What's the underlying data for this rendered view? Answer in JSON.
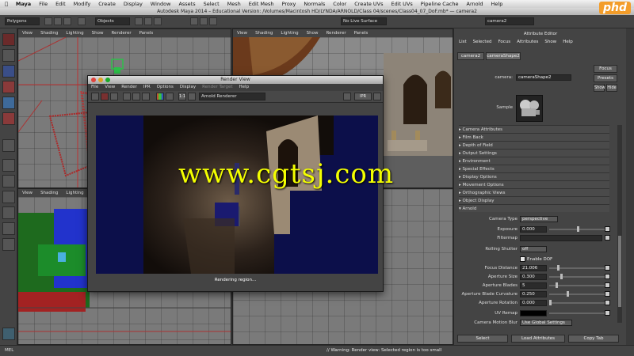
{
  "mac_menu": [
    "Maya",
    "File",
    "Edit",
    "Modify",
    "Create",
    "Display",
    "Window",
    "Assets",
    "Select",
    "Mesh",
    "Edit Mesh",
    "Proxy",
    "Normals",
    "Color",
    "Create UVs",
    "Edit UVs",
    "Pipeline Cache",
    "Arnold",
    "Help"
  ],
  "window_title": "Autodesk Maya 2014 – Educational Version: /Volumes/Macintosh HD/LYNDA/ARNOLD/Class 04/scenes/Class04_07_DoF.mb* — camera2",
  "status_line": {
    "menu_set": "Polygons",
    "objects_field": "Objects",
    "live_surface": "No Live Surface",
    "name_field": "camera2"
  },
  "pane_menu": [
    "View",
    "Shading",
    "Lighting",
    "Show",
    "Renderer",
    "Panels"
  ],
  "render_view": {
    "title": "Render View",
    "menu": [
      "File",
      "View",
      "Render",
      "IPR",
      "Options",
      "Display",
      "Render Target",
      "Help"
    ],
    "renderer": "Arnold Renderer",
    "zoom": "1:1",
    "ratio": "IPR",
    "status": "Rendering region..."
  },
  "attribute_editor": {
    "title": "Attribute Editor",
    "menu": [
      "List",
      "Selected",
      "Focus",
      "Attributes",
      "Show",
      "Help"
    ],
    "tabs": [
      "camera2",
      "cameraShape2"
    ],
    "node_label": "camera:",
    "node_value": "cameraShape2",
    "buttons": {
      "focus": "Focus",
      "presets": "Presets",
      "show": "Show",
      "hide": "Hide"
    },
    "sample_label": "Sample",
    "sections": [
      "Camera Attributes",
      "Film Back",
      "Depth of Field",
      "Output Settings",
      "Environment",
      "Special Effects",
      "Display Options",
      "Movement Options",
      "Orthographic Views",
      "Object Display",
      "Arnold"
    ],
    "arnold": {
      "camera_type_label": "Camera Type",
      "camera_type_value": "perspective",
      "exposure_label": "Exposure",
      "exposure_value": "0.000",
      "filtermap_label": "Filtermap",
      "rolling_shutter_label": "Rolling Shutter",
      "rolling_shutter_value": "off",
      "enable_dof_label": "Enable DOF",
      "focus_distance_label": "Focus Distance",
      "focus_distance_value": "21.006",
      "aperture_size_label": "Aperture Size",
      "aperture_size_value": "0.300",
      "aperture_blades_label": "Aperture Blades",
      "aperture_blades_value": "5",
      "blade_curvature_label": "Aperture Blade Curvature",
      "blade_curvature_value": "0.250",
      "aperture_rotation_label": "Aperture Rotation",
      "aperture_rotation_value": "0.000",
      "uv_remap_label": "UV Remap",
      "motion_blur_label": "Camera Motion Blur",
      "motion_blur_value": "Use Global Settings"
    },
    "bottom_buttons": [
      "Select",
      "Load Attributes",
      "Copy Tab"
    ]
  },
  "help_line": {
    "prefix": "MEL",
    "warning": "// Warning: Render view: Selected region is too small"
  },
  "watermark": "www.cgtsj.com",
  "logo_text": "phd",
  "colors": {
    "render_bg": "#0c0f4a",
    "watermark": "#f4ff00"
  }
}
